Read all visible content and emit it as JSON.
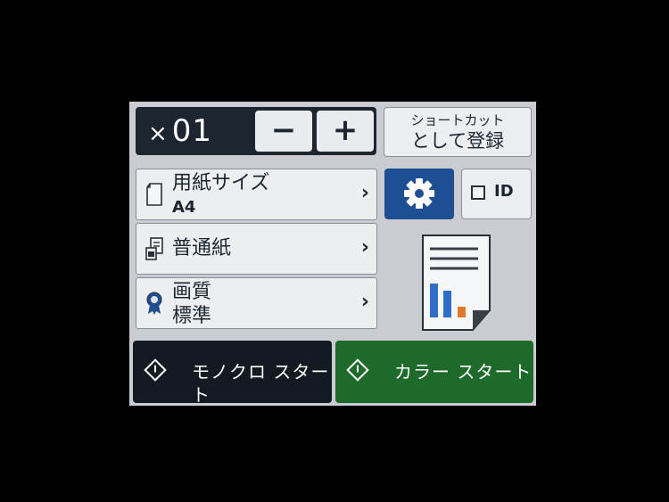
{
  "copies": {
    "prefix": "×",
    "count": "01"
  },
  "stepper": {
    "minus_label": "−",
    "plus_label": "+"
  },
  "shortcut": {
    "line1": "ショートカット",
    "line2": "として登録"
  },
  "rows": [
    {
      "title": "用紙サイズ",
      "value": "A4",
      "icon": "paper-size-icon"
    },
    {
      "title": "普通紙",
      "icon": "paper-type-icon"
    },
    {
      "title": "画質",
      "value": "標準",
      "icon": "quality-ribbon-icon"
    }
  ],
  "chevron": "›",
  "id_button": {
    "label": "ID",
    "checked": false
  },
  "settings": {
    "icon": "gear-icon"
  },
  "start": {
    "mono_label": "モノクロ スタート",
    "color_label": "カラー スタート"
  },
  "colors": {
    "screen_bg": "#c9ccd0",
    "dark": "#1c2530",
    "settings_blue": "#1f4f93",
    "mono_bg": "#131a21",
    "color_green": "#1e6a2a"
  }
}
